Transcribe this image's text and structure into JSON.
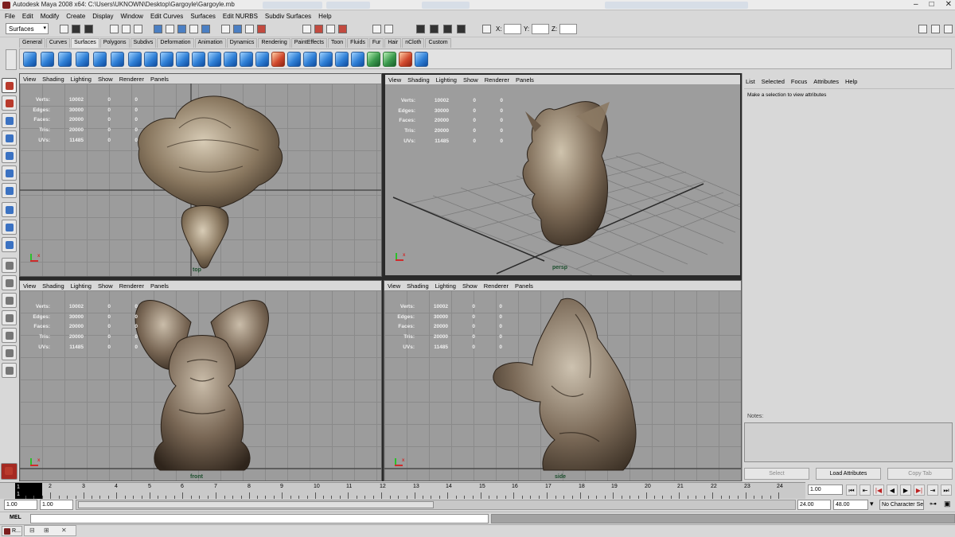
{
  "window": {
    "title": "Autodesk Maya 2008 x64: C:\\Users\\UKNOWN\\Desktop\\Gargoyle\\Gargoyle.mb",
    "controls": [
      "–",
      "□",
      "✕"
    ]
  },
  "menubar": [
    "File",
    "Edit",
    "Modify",
    "Create",
    "Display",
    "Window",
    "Edit Curves",
    "Surfaces",
    "Edit NURBS",
    "Subdiv Surfaces",
    "Help"
  ],
  "statusline": {
    "menuset": "Surfaces",
    "x_label": "X:",
    "y_label": "Y:",
    "z_label": "Z:"
  },
  "shelf": {
    "tabs": [
      "General",
      "Curves",
      "Surfaces",
      "Polygons",
      "Subdivs",
      "Deformation",
      "Animation",
      "Dynamics",
      "Rendering",
      "PaintEffects",
      "Toon",
      "Fluids",
      "Fur",
      "Hair",
      "nCloth",
      "Custom"
    ],
    "active_tab": "Surfaces"
  },
  "viewport_menu": [
    "View",
    "Shading",
    "Lighting",
    "Show",
    "Renderer",
    "Panels"
  ],
  "hud": {
    "rows": [
      {
        "label": "Verts:",
        "value": "10002",
        "a": "0",
        "b": "0"
      },
      {
        "label": "Edges:",
        "value": "30000",
        "a": "0",
        "b": "0"
      },
      {
        "label": "Faces:",
        "value": "20000",
        "a": "0",
        "b": "0"
      },
      {
        "label": "Tris:",
        "value": "20000",
        "a": "0",
        "b": "0"
      },
      {
        "label": "UVs:",
        "value": "11485",
        "a": "0",
        "b": "0"
      }
    ]
  },
  "viewports": {
    "top_label": "top",
    "persp_label": "persp",
    "front_label": "front",
    "side_label": "side"
  },
  "attribute_editor": {
    "menu": [
      "List",
      "Selected",
      "Focus",
      "Attributes",
      "Help"
    ],
    "message": "Make a selection to view attributes",
    "notes_label": "Notes:",
    "buttons": {
      "select": "Select",
      "load": "Load Attributes",
      "copy": "Copy Tab"
    }
  },
  "timeline": {
    "current_frame": "1",
    "current_frame_sub": "1",
    "ticks": [
      "2",
      "3",
      "4",
      "5",
      "6",
      "7",
      "8",
      "9",
      "10",
      "11",
      "12",
      "13",
      "14",
      "15",
      "16",
      "17",
      "18",
      "19",
      "20",
      "21",
      "22",
      "23",
      "24"
    ],
    "frame_field": "1.00"
  },
  "range": {
    "start_a": "1.00",
    "start_b": "1.00",
    "end_a": "24.00",
    "end_b": "48.00",
    "character_set": "No Character Set"
  },
  "command_line": {
    "label": "MEL"
  },
  "taskbar": {
    "item": "R..."
  }
}
